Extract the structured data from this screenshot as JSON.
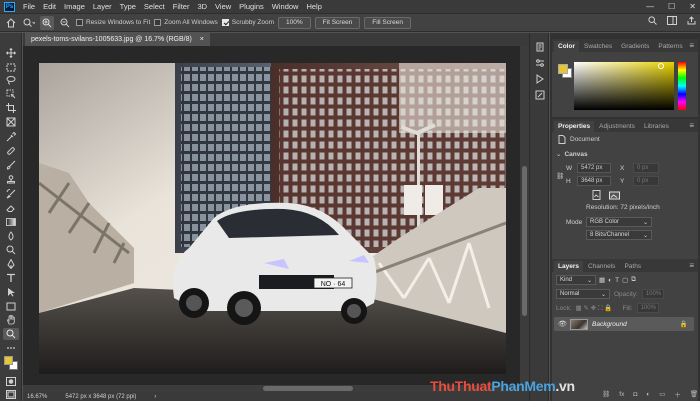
{
  "app": {
    "logo_text": "Ps"
  },
  "menu": [
    "File",
    "Edit",
    "Image",
    "Layer",
    "Type",
    "Select",
    "Filter",
    "3D",
    "View",
    "Plugins",
    "Window",
    "Help"
  ],
  "window_controls": {
    "minimize": "—",
    "maximize": "☐",
    "close": "✕"
  },
  "options": {
    "resize_windows": {
      "label": "Resize Windows to Fit",
      "checked": false
    },
    "zoom_all": {
      "label": "Zoom All Windows",
      "checked": false
    },
    "scrubby": {
      "label": "Scrubby Zoom",
      "checked": true
    },
    "btn_100": "100%",
    "btn_fit": "Fit Screen",
    "btn_fill": "Fill Screen"
  },
  "document": {
    "tab_title": "pexels-toms-svilans-1005633.jpg @ 16.7% (RGB/8)",
    "close": "×",
    "plate_text": "NO · 64"
  },
  "status": {
    "zoom": "16.67%",
    "info": "5472 px x 3648 px (72 ppi)"
  },
  "color_panel": {
    "tabs": [
      "Color",
      "Swatches",
      "Gradients",
      "Patterns"
    ],
    "fg_color": "#e8c535",
    "bg_color": "#ffffff"
  },
  "properties": {
    "tabs": [
      "Properties",
      "Adjustments",
      "Libraries"
    ],
    "kind": "Document",
    "section": "Canvas",
    "w_label": "W",
    "w_value": "5472 px",
    "h_label": "H",
    "h_value": "3648 px",
    "x_label": "X",
    "x_value": "0 px",
    "y_label": "Y",
    "y_value": "0 px",
    "resolution": "Resolution: 72 pixels/inch",
    "mode_label": "Mode",
    "mode_value": "RGB Color",
    "depth_value": "8 Bits/Channel"
  },
  "layers": {
    "tabs": [
      "Layers",
      "Channels",
      "Paths"
    ],
    "kind_placeholder": "Kind",
    "blend_mode": "Normal",
    "opacity_label": "Opacity:",
    "opacity_value": "100%",
    "lock_label": "Lock:",
    "fill_label": "Fill:",
    "fill_value": "100%",
    "layer_name": "Background"
  },
  "watermark": {
    "part1": "ThuThuat",
    "part2": "PhanMem",
    "part3": ".vn"
  }
}
